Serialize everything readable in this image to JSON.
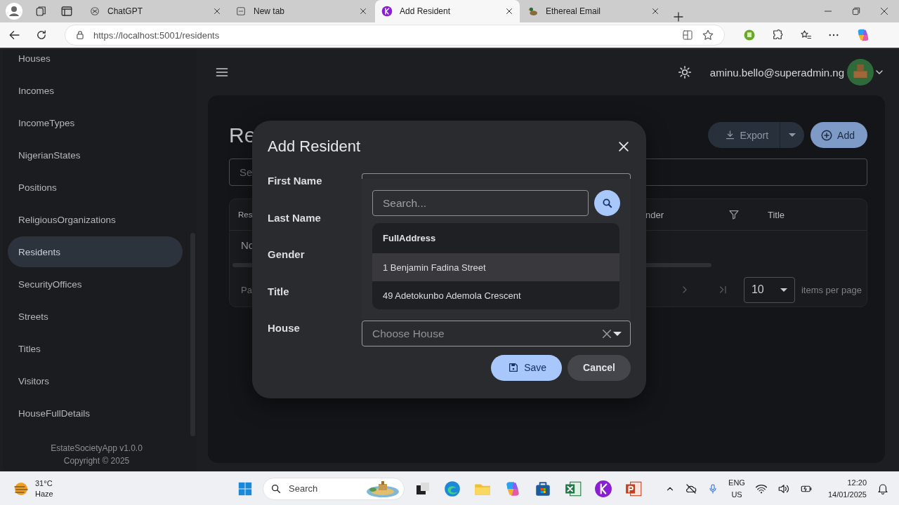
{
  "browser": {
    "tabs": [
      {
        "title": "ChatGPT",
        "selected": false
      },
      {
        "title": "New tab",
        "selected": false
      },
      {
        "title": "Add Resident",
        "selected": true
      },
      {
        "title": "Ethereal Email",
        "selected": false
      }
    ],
    "url": "https://localhost:5001/residents"
  },
  "sidebar": {
    "items": [
      {
        "label": "Houses",
        "selected": false
      },
      {
        "label": "Incomes",
        "selected": false
      },
      {
        "label": "IncomeTypes",
        "selected": false
      },
      {
        "label": "NigerianStates",
        "selected": false
      },
      {
        "label": "Positions",
        "selected": false
      },
      {
        "label": "ReligiousOrganizations",
        "selected": false
      },
      {
        "label": "Residents",
        "selected": true
      },
      {
        "label": "SecurityOffices",
        "selected": false
      },
      {
        "label": "Streets",
        "selected": false
      },
      {
        "label": "Titles",
        "selected": false
      },
      {
        "label": "Visitors",
        "selected": false
      },
      {
        "label": "HouseFullDetails",
        "selected": false
      }
    ],
    "footer": [
      "EstateSocietyApp v1.0.0",
      "Copyright © 2025"
    ]
  },
  "topbar": {
    "user_email": "aminu.bello@superadmin.ng"
  },
  "page": {
    "title": "Re",
    "search_placeholder": "Se",
    "export_label": "Export",
    "add_label": "Add",
    "table": {
      "columns": [
        "Res",
        "nder",
        "Title"
      ],
      "empty_text": "No",
      "pager_text": "Pa",
      "page_size": "10",
      "page_size_label": "items per page"
    }
  },
  "dialog": {
    "title": "Add Resident",
    "fields": [
      {
        "label": "First Name"
      },
      {
        "label": "Last Name"
      },
      {
        "label": "Gender"
      },
      {
        "label": "Title"
      },
      {
        "label": "House",
        "placeholder": "Choose House"
      }
    ],
    "dropdown": {
      "search_placeholder": "Search...",
      "header": "FullAddress",
      "options": [
        {
          "label": "1 Benjamin Fadina Street",
          "highlighted": true
        },
        {
          "label": "49 Adetokunbo Ademola Crescent",
          "highlighted": false
        }
      ]
    },
    "save_label": "Save",
    "cancel_label": "Cancel"
  },
  "taskbar": {
    "temperature": "31°C",
    "condition": "Haze",
    "search_placeholder": "Search",
    "language": "ENG",
    "region": "US",
    "time": "12:20",
    "date": "14/01/2025"
  }
}
